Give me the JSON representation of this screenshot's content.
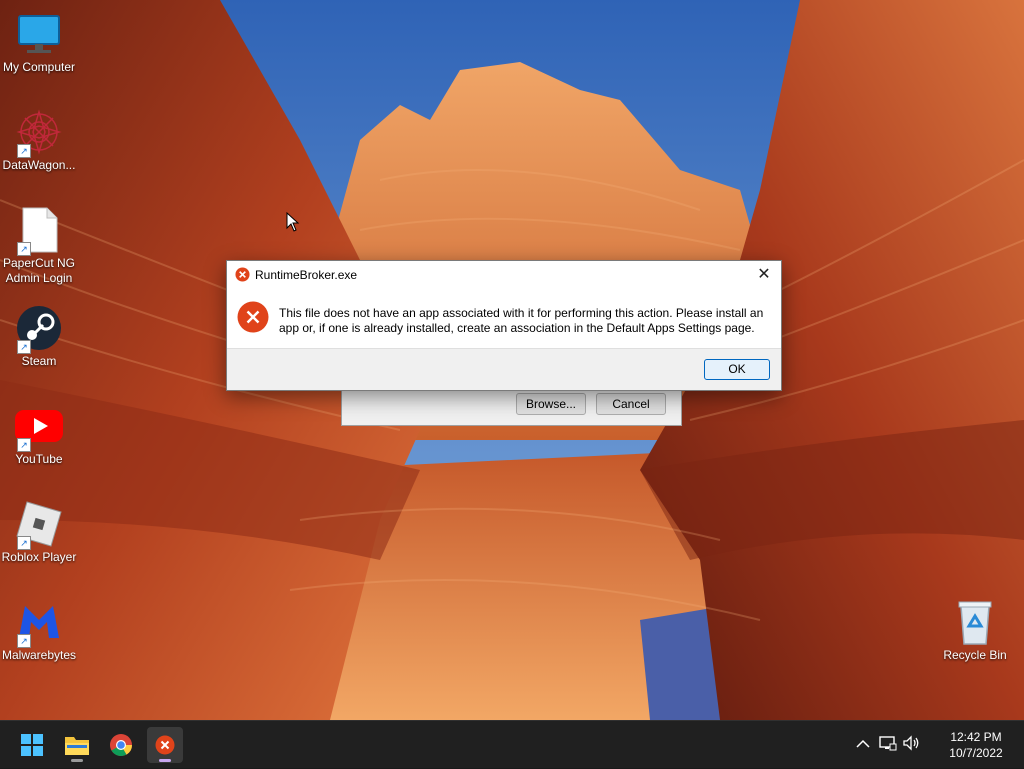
{
  "desktop": {
    "icons": [
      {
        "label": "My Computer",
        "icon": "monitor-icon"
      },
      {
        "label": "DataWagon...",
        "icon": "datawagon-icon"
      },
      {
        "label": "PaperCut NG Admin Login",
        "icon": "file-icon"
      },
      {
        "label": "Steam",
        "icon": "steam-icon"
      },
      {
        "label": "YouTube",
        "icon": "youtube-icon"
      },
      {
        "label": "Roblox Player",
        "icon": "roblox-icon"
      },
      {
        "label": "Malwarebytes",
        "icon": "malwarebytes-icon"
      },
      {
        "label": "Recycle Bin",
        "icon": "recycle-bin-icon"
      }
    ]
  },
  "bg_dialog": {
    "browse_label": "Browse...",
    "cancel_label": "Cancel"
  },
  "error_dialog": {
    "title": "RuntimeBroker.exe",
    "message": "This file does not have an app associated with it for performing this action. Please install an app or, if one is already installed, create an association in the Default Apps Settings page.",
    "ok_label": "OK",
    "close_glyph": "✕",
    "error_color": "#e0431a"
  },
  "taskbar": {
    "items": [
      "start-icon",
      "file-explorer-icon",
      "chrome-icon",
      "error-app-icon"
    ],
    "tray": {
      "chevron": "^",
      "time": "12:42 PM",
      "date": "10/7/2022"
    }
  },
  "colors": {
    "taskbar": "#202020",
    "accent": "#0067c0"
  }
}
